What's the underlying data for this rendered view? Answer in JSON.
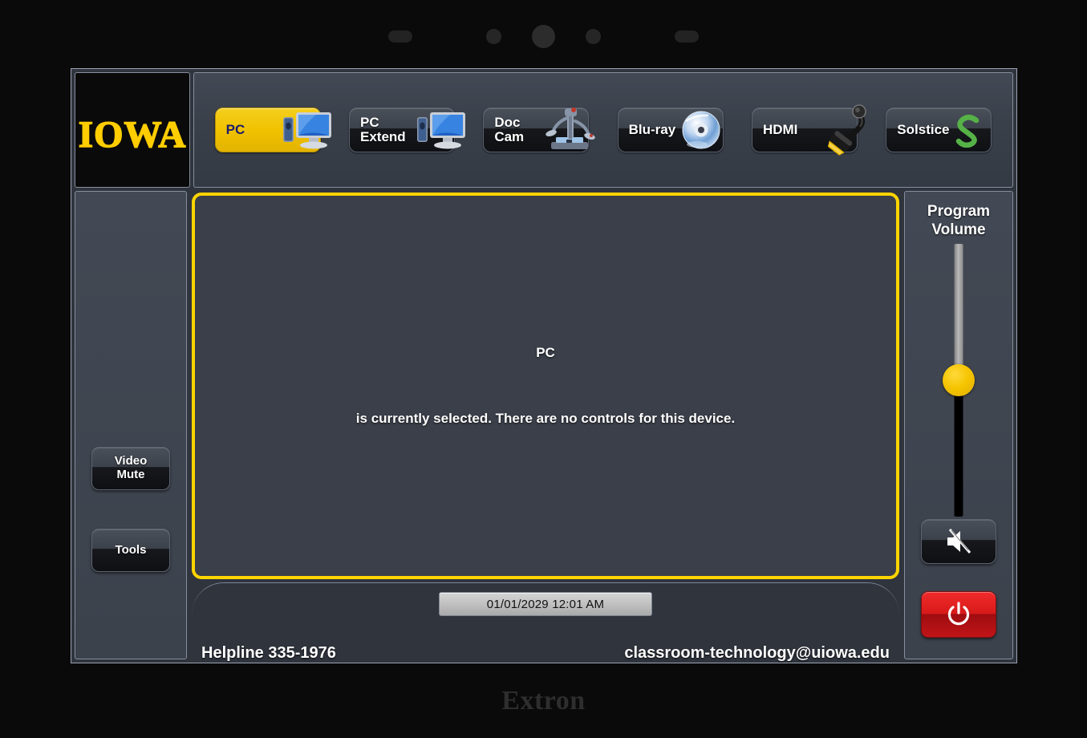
{
  "device": {
    "brand": "Extron",
    "bezel_buttons": [
      "pill-left",
      "dot-small-left",
      "dot-large-center",
      "dot-small-right",
      "pill-right"
    ]
  },
  "header": {
    "logo_text": "IOWA",
    "sources": [
      {
        "label": "PC",
        "icon": "computer-icon",
        "selected": true
      },
      {
        "label": "PC\nExtend",
        "icon": "computer-icon",
        "selected": false
      },
      {
        "label": "Doc\nCam",
        "icon": "doc-cam-icon",
        "selected": false
      },
      {
        "label": "Blu-ray",
        "icon": "bluray-disc-icon",
        "selected": false
      },
      {
        "label": "HDMI",
        "icon": "hdmi-cable-icon",
        "selected": false
      },
      {
        "label": "Solstice",
        "icon": "solstice-s-icon",
        "selected": false
      }
    ]
  },
  "left_rail": {
    "buttons": [
      {
        "label": "Video\nMute",
        "name": "video-mute-button"
      },
      {
        "label": "Tools",
        "name": "tools-button"
      }
    ]
  },
  "main": {
    "selected_source": "PC",
    "message": "is currently selected. There are no controls for this device.",
    "border_color": "#FFD400",
    "panel_color": "#3a3f49"
  },
  "bottom_bar": {
    "datetime": "01/01/2029  12:01 AM",
    "helpline": "Helpline 335-1976",
    "email": "classroom-technology@uiowa.edu"
  },
  "right_rail": {
    "volume_label": "Program\nVolume",
    "volume_percent": 50,
    "knob_color": "#F5C400",
    "mute_icon": "speaker-mute-icon",
    "power_icon": "power-icon",
    "power_color": "#D81A1A"
  }
}
